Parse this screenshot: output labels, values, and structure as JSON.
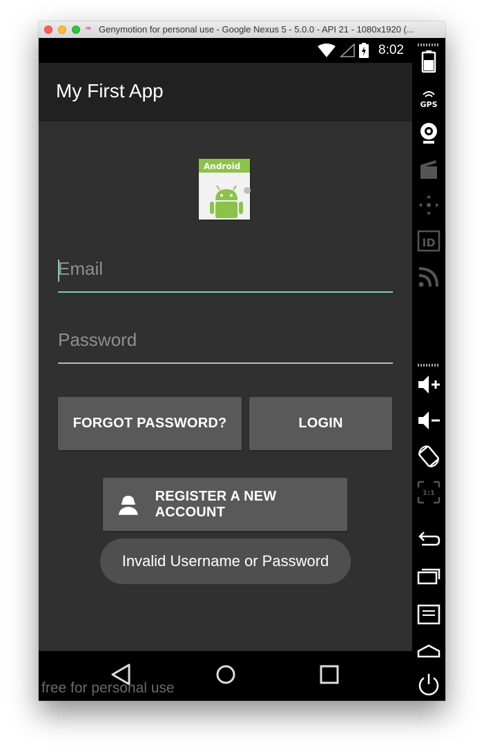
{
  "window": {
    "title": "Genymotion for personal use - Google Nexus 5 - 5.0.0 - API 21 - 1080x1920 (..."
  },
  "statusbar": {
    "time": "8:02"
  },
  "app": {
    "title": "My First App",
    "icon_label": "Android"
  },
  "form": {
    "email_placeholder": "Email",
    "password_placeholder": "Password",
    "forgot_label": "FORGOT PASSWORD?",
    "login_label": "LOGIN",
    "register_label": "REGISTER A NEW ACCOUNT"
  },
  "toast": {
    "message": "Invalid Username or Password"
  },
  "watermark": "free for personal use",
  "sidebar": {
    "gps_label": "GPS",
    "id_label": "ID",
    "ratio_label": "1:1"
  },
  "colors": {
    "accent": "#80cbc4",
    "app_bar": "#212121",
    "background": "#303030",
    "button": "#595959",
    "toast": "#4f4f4f"
  }
}
